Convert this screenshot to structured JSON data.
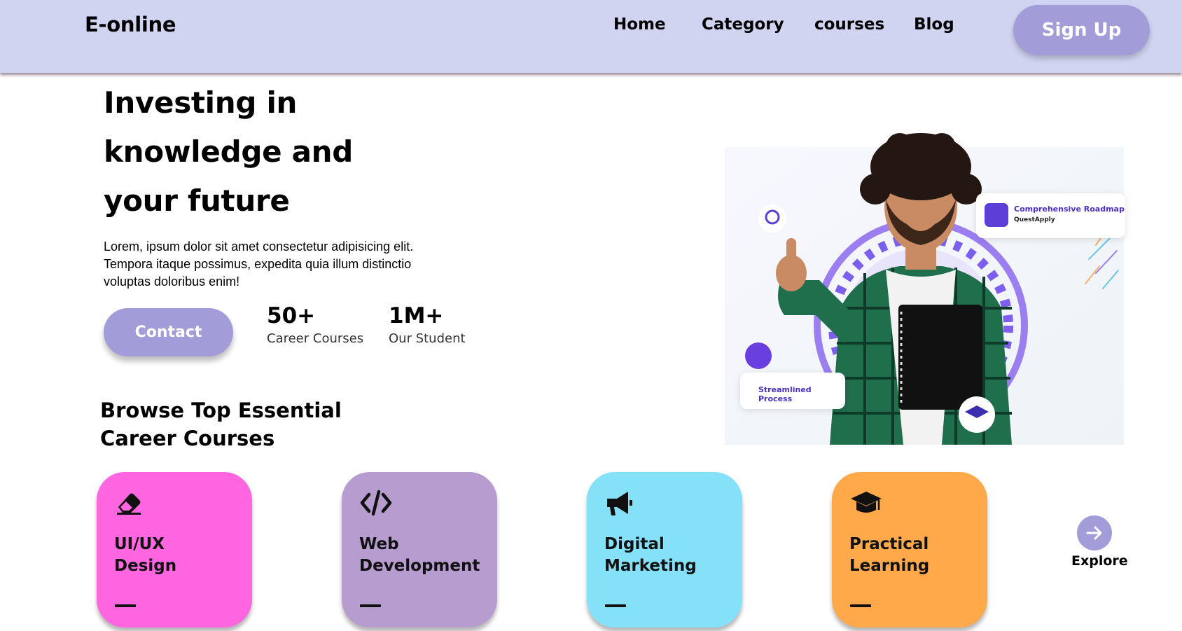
{
  "header": {
    "logo": "E-online",
    "nav": [
      "Home",
      "Category",
      "courses",
      "Blog"
    ],
    "signup_label": "Sign Up"
  },
  "hero": {
    "title_lines": [
      "Investing in",
      "knowledge and",
      "your future"
    ],
    "description": "Lorem, ipsum dolor sit amet consectetur adipisicing elit. Tempora itaque possimus, expedita quia illum distinctio voluptas doloribus enim!",
    "contact_label": "Contact",
    "stats": [
      {
        "value": "50+",
        "label": "Career Courses"
      },
      {
        "value": "1M+",
        "label": "Our Student"
      }
    ],
    "image_tags": {
      "roadmap_title": "Comprehensive Roadmap",
      "roadmap_sub": "QuestApply",
      "process": "Streamlined Process"
    }
  },
  "courses": {
    "title_lines": [
      "Browse Top Essential",
      "Career Courses"
    ],
    "cards": [
      {
        "line1": "UI/UX",
        "line2": "Design",
        "color": "#ff66e0",
        "icon": "eraser-icon"
      },
      {
        "line1": "Web",
        "line2": "Development",
        "color": "#b69ccf",
        "icon": "code-icon"
      },
      {
        "line1": "Digital",
        "line2": "Marketing",
        "color": "#85e1f8",
        "icon": "megaphone-icon"
      },
      {
        "line1": "Practical",
        "line2": "Learning",
        "color": "#ffa94a",
        "icon": "graduation-cap-icon"
      }
    ],
    "explore_label": "Explore"
  },
  "colors": {
    "header_bg": "#d0d4f0",
    "accent": "#a29cd8"
  }
}
